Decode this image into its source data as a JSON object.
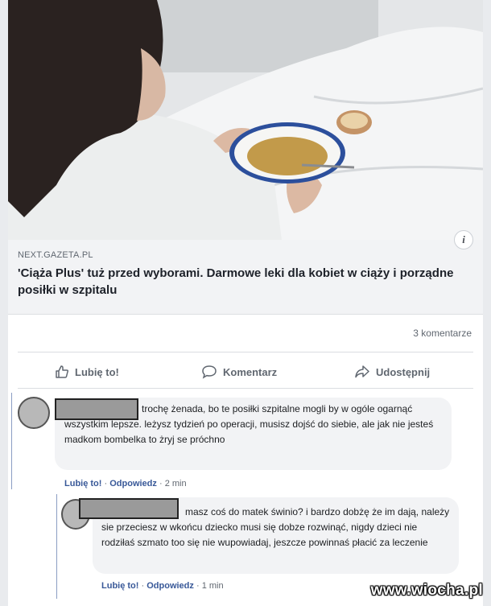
{
  "link": {
    "domain": "NEXT.GAZETA.PL",
    "headline": "'Ciąża Plus' tuż przed wyborami. Darmowe leki dla kobiet w ciąży i porządne posiłki w szpitalu",
    "info_glyph": "i"
  },
  "post": {
    "comment_count": "3 komentarze"
  },
  "actions": {
    "like": "Lubię to!",
    "comment": "Komentarz",
    "share": "Udostępnij"
  },
  "comments": [
    {
      "text": "trochę żenada, bo te posiłki szpitalne mogli by w ogóle ogarnąć wszystkim lepsze. leżysz tydzień po operacji, musisz dojść do siebie, ale jak nie jesteś madkom bombelka to żryj se próchno",
      "like": "Lubię to!",
      "reply": "Odpowiedz",
      "time": "2 min"
    },
    {
      "text": "masz coś do matek świnio? i bardzo dobżę że im dają, należy sie przeciesz w wkońcu dziecko musi się dobze rozwinąć, nigdy dzieci nie rodziłaś szmato too się nie wupowiadaj, jeszcze powinnaś płacić za leczenie",
      "like": "Lubię to!",
      "reply": "Odpowiedz",
      "time": "1 min"
    }
  ],
  "watermark": "www.wiocha.pl",
  "colors": {
    "link_blue": "#385898",
    "meta_gray": "#606770",
    "bubble": "#f2f3f5"
  }
}
